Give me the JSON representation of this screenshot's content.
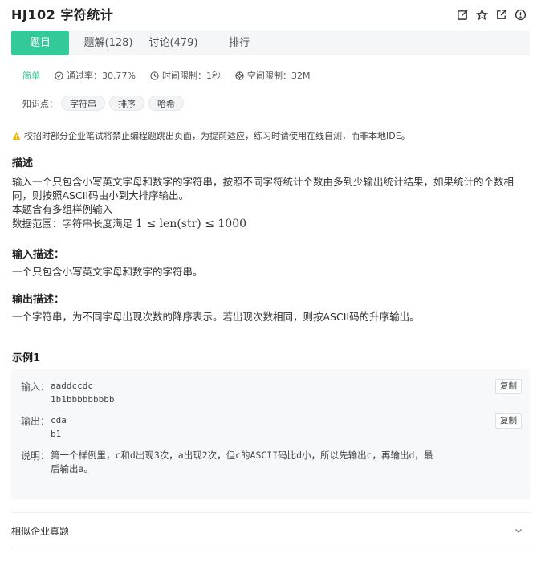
{
  "header": {
    "title": "HJ102  字符统计",
    "icons": [
      "edit-icon",
      "star-icon",
      "external-link-icon",
      "info-icon"
    ]
  },
  "tabs": [
    {
      "label": "题目",
      "active": true
    },
    {
      "label": "题解(128)",
      "active": false
    },
    {
      "label": "讨论(479)",
      "active": false
    },
    {
      "label": "排行",
      "active": false
    }
  ],
  "meta": {
    "level": "简单",
    "pass_rate": "通过率：30.77%",
    "time_limit": "时间限制：1秒",
    "space_limit": "空间限制：32M"
  },
  "knowledge": {
    "label": "知识点：",
    "tags": [
      "字符串",
      "排序",
      "哈希"
    ]
  },
  "warning": "校招时部分企业笔试将禁止编程题跳出页面，为提前适应，练习时请使用在线自测，而非本地IDE。",
  "description": {
    "title": "描述",
    "line1": "输入一个只包含小写英文字母和数字的字符串，按照不同字符统计个数由多到少输出统计结果，如果统计的个数相",
    "line2": "同，则按照ASCII码由小到大排序输出。",
    "line3": "本题含有多组样例输入",
    "range_prefix": "数据范围：字符串长度满足",
    "range_math": "1 ≤ len(str) ≤ 1000"
  },
  "input_desc": {
    "title": "输入描述：",
    "text": "一个只包含小写英文字母和数字的字符串。"
  },
  "output_desc": {
    "title": "输出描述：",
    "text": "一个字符串，为不同字母出现次数的降序表示。若出现次数相同，则按ASCII码的升序输出。"
  },
  "example": {
    "title": "示例1",
    "input_label": "输入：",
    "input_lines": [
      "aaddccdc",
      "1b1bbbbbbbbb"
    ],
    "output_label": "输出：",
    "output_lines": [
      "cda",
      "b1"
    ],
    "explain_label": "说明：",
    "explain_line1": "第一个样例里，c和d出现3次，a出现2次，但c的ASCII码比d小，所以先输出c，再输出d，最",
    "explain_line2": "后输出a。",
    "copy_label": "复制"
  },
  "similar": {
    "label": "相似企业真题"
  },
  "colors": {
    "accent": "#32ca99",
    "warning": "#f5b400"
  }
}
